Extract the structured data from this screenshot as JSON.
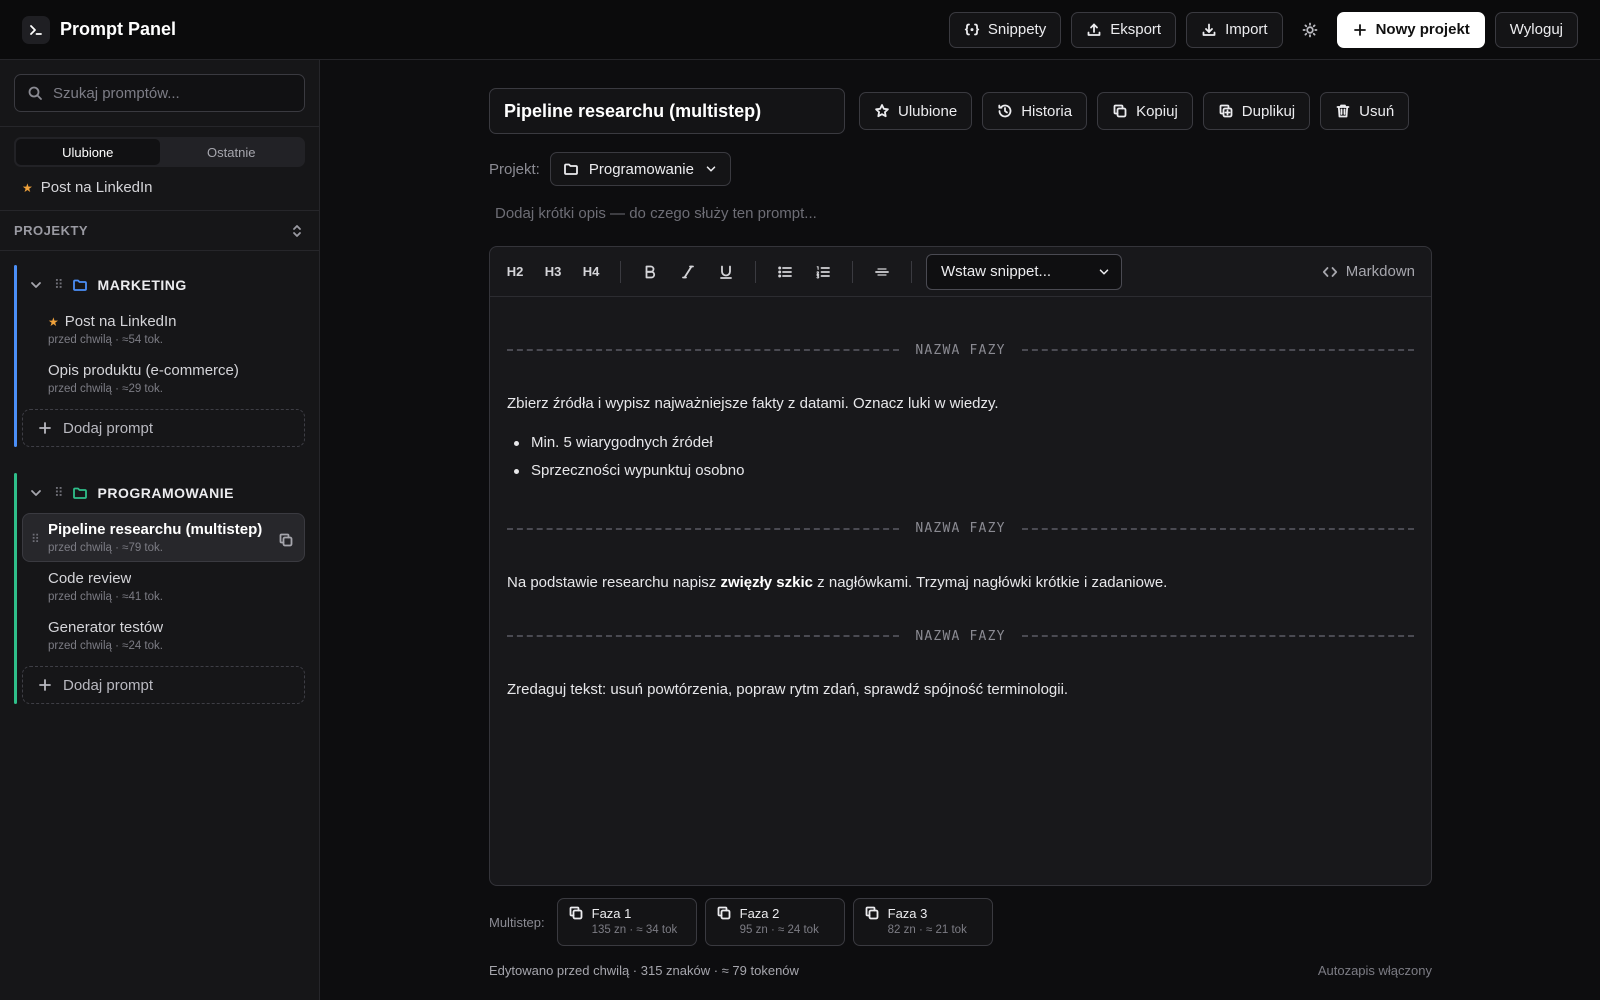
{
  "app": {
    "title": "Prompt Panel",
    "accent": "#ffffff",
    "star_color": "#f0a23b"
  },
  "topbar": {
    "snippets": "Snippety",
    "export": "Eksport",
    "import": "Import",
    "new_project": "Nowy projekt",
    "logout": "Wyloguj"
  },
  "sidebar": {
    "search_placeholder": "Szukaj promptów...",
    "tabs": {
      "favorites": "Ulubione",
      "recent": "Ostatnie"
    },
    "favorites": [
      {
        "label": "Post na LinkedIn"
      }
    ],
    "projects_header": "PROJEKTY",
    "projects": [
      {
        "name": "MARKETING",
        "color": "#4b8ff7",
        "items": [
          {
            "title": "Post na LinkedIn",
            "meta": "przed chwilą · ≈54 tok.",
            "favorite": true
          },
          {
            "title": "Opis produktu (e-commerce)",
            "meta": "przed chwilą · ≈29 tok.",
            "favorite": false
          }
        ],
        "add_label": "Dodaj prompt"
      },
      {
        "name": "PROGRAMOWANIE",
        "color": "#2fbf8a",
        "items": [
          {
            "title": "Pipeline researchu (multistep)",
            "meta": "przed chwilą · ≈79 tok.",
            "active": true
          },
          {
            "title": "Code review",
            "meta": "przed chwilą · ≈41 tok."
          },
          {
            "title": "Generator testów",
            "meta": "przed chwilą · ≈24 tok."
          }
        ],
        "add_label": "Dodaj prompt"
      }
    ]
  },
  "editor": {
    "title_value": "Pipeline researchu (multistep)",
    "actions": {
      "favorite": "Ulubione",
      "history": "Historia",
      "copy": "Kopiuj",
      "duplicate": "Duplikuj",
      "delete": "Usuń"
    },
    "project_label": "Projekt:",
    "project_value": "Programowanie",
    "description_placeholder": "Dodaj krótki opis — do czego służy ten prompt...",
    "toolbar": {
      "h2": "H2",
      "h3": "H3",
      "h4": "H4",
      "snippet_placeholder": "Wstaw snippet...",
      "markdown": "Markdown"
    },
    "phase_label": "NAZWA FAZY",
    "phase1_text": "Zbierz źródła i wypisz najważniejsze fakty z datami. Oznacz luki w wiedzy.",
    "phase1_bullets": [
      "Min. 5 wiarygodnych źródeł",
      "Sprzeczności wypunktuj osobno"
    ],
    "phase2_before": "Na podstawie researchu napisz ",
    "phase2_bold": "zwięzły szkic",
    "phase2_after": " z nagłówkami. Trzymaj nagłówki krótkie i zadaniowe.",
    "phase3_text": "Zredaguj tekst: usuń powtórzenia, popraw rytm zdań, sprawdź spójność terminologii."
  },
  "multistep": {
    "label": "Multistep:",
    "phases": [
      {
        "name": "Faza 1",
        "meta": "135 zn · ≈ 34 tok"
      },
      {
        "name": "Faza 2",
        "meta": "95 zn · ≈ 24 tok"
      },
      {
        "name": "Faza 3",
        "meta": "82 zn · ≈ 21 tok"
      }
    ]
  },
  "footer": {
    "status": "Edytowano przed chwilą · 315 znaków · ≈ 79 tokenów",
    "autosave": "Autozapis włączony"
  }
}
